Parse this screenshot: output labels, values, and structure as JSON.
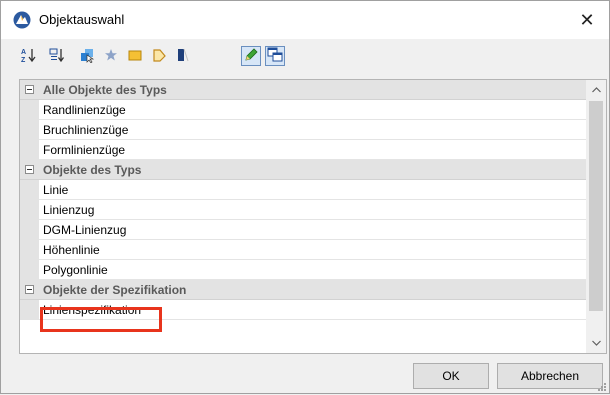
{
  "window": {
    "title": "Objektauswahl",
    "close_glyph": "✕"
  },
  "toolbar": {
    "buttons": [
      {
        "name": "sort-alphabetical-icon",
        "pressed": false
      },
      {
        "name": "sort-category-icon",
        "pressed": false
      },
      {
        "name": "select-objects-icon",
        "pressed": false
      },
      {
        "name": "star-icon",
        "pressed": false
      },
      {
        "name": "rectangle-icon",
        "pressed": false
      },
      {
        "name": "polygon-icon",
        "pressed": false
      },
      {
        "name": "book-icon",
        "pressed": false
      },
      {
        "name": "pencil-edit-icon",
        "pressed": true
      },
      {
        "name": "overlap-windows-icon",
        "pressed": true
      }
    ]
  },
  "grid": {
    "categories": [
      {
        "label": "Alle Objekte des Typs",
        "items": [
          "Randlinienzüge",
          "Bruchlinienzüge",
          "Formlinienzüge"
        ]
      },
      {
        "label": "Objekte des Typs",
        "items": [
          "Linie",
          "Linienzug",
          "DGM-Linienzug",
          "Höhenlinie",
          "Polygonlinie"
        ]
      },
      {
        "label": "Objekte der Spezifikation",
        "items": [
          "Linienspezifikation"
        ]
      }
    ],
    "highlighted_item": "Linienspezifikation"
  },
  "buttons": {
    "ok": "OK",
    "cancel": "Abbrechen"
  },
  "colors": {
    "highlight": "#e8341c",
    "category_bg": "#e3e3e3",
    "pressed_bg": "#d7e6f7"
  }
}
